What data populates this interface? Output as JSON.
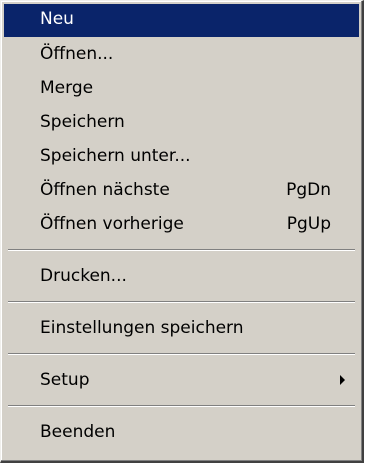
{
  "menu": {
    "items": [
      {
        "label": "Neu",
        "shortcut": "",
        "selected": true
      },
      {
        "label": "Öffnen...",
        "shortcut": ""
      },
      {
        "label": "Merge",
        "shortcut": ""
      },
      {
        "label": "Speichern",
        "shortcut": ""
      },
      {
        "label": "Speichern unter...",
        "shortcut": ""
      },
      {
        "label": "Öffnen nächste",
        "shortcut": "PgDn"
      },
      {
        "label": "Öffnen vorherige",
        "shortcut": "PgUp"
      },
      {
        "label": "Drucken...",
        "shortcut": ""
      },
      {
        "label": "Einstellungen speichern",
        "shortcut": ""
      },
      {
        "label": "Setup",
        "shortcut": "",
        "submenu_icon": "submenu-arrow-icon"
      },
      {
        "label": "Beenden",
        "shortcut": ""
      }
    ]
  },
  "colors": {
    "menu_background": "#d4d0c8",
    "selection_background": "#0a246a",
    "selection_text": "#ffffff",
    "text": "#000000"
  }
}
